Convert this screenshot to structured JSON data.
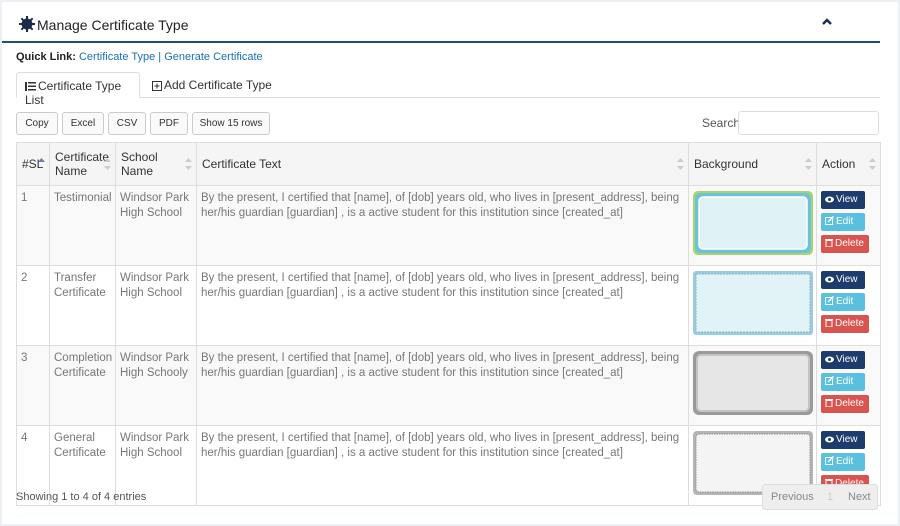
{
  "header": {
    "title": "Manage Certificate Type"
  },
  "quick_links": {
    "label": "Quick Link:",
    "link1": "Certificate Type",
    "separator": "|",
    "link2": "Generate Certificate"
  },
  "tabs": {
    "list": "Certificate Type List",
    "add": "Add Certificate Type"
  },
  "toolbar": {
    "copy": "Copy",
    "excel": "Excel",
    "csv": "CSV",
    "pdf": "PDF",
    "show_rows": "Show 15 rows",
    "search_label": "Search:",
    "search_value": ""
  },
  "table": {
    "headers": {
      "sl": "#SL",
      "name": "Certificate Name",
      "school": "School Name",
      "text": "Certificate Text",
      "background": "Background",
      "action": "Action"
    },
    "rows": [
      {
        "sl": "1",
        "name": "Testimonial",
        "school": "Windsor Park High School",
        "text": "By the present, I certified that [name], of [dob] years old, who lives in [present_address], being her/his guardian [guardian] , is a active student for this institution since [created_at]",
        "background": "certificate-border-blue-green"
      },
      {
        "sl": "2",
        "name": "Transfer Certificate",
        "school": "Windsor Park High School",
        "text": "By the present, I certified that [name], of [dob] years old, who lives in [present_address], being her/his guardian [guardian] , is a active student for this institution since [created_at]",
        "background": "certificate-border-light-blue"
      },
      {
        "sl": "3",
        "name": "Completion Certificate",
        "school": "Windsor Park High Schooly",
        "text": "By the present, I certified that [name], of [dob] years old, who lives in [present_address], being her/his guardian [guardian] , is a active student for this institution since [created_at]",
        "background": "certificate-border-gray"
      },
      {
        "sl": "4",
        "name": "General Certificate",
        "school": "Windsor Park High School",
        "text": "By the present, I certified that [name], of [dob] years old, who lives in [present_address], being her/his guardian [guardian] , is a active student for this institution since [created_at]",
        "background": "certificate-border-silver"
      }
    ],
    "actions": {
      "view": "View",
      "edit": "Edit",
      "delete": "Delete"
    }
  },
  "footer": {
    "info": "Showing 1 to 4 of 4 entries",
    "previous": "Previous",
    "page": "1",
    "next": "Next"
  },
  "colors": {
    "header_border": "#1f4e79",
    "link": "#1a6fb5",
    "view": "#1d3c6e",
    "edit": "#5bc0de",
    "delete": "#d9534f"
  }
}
